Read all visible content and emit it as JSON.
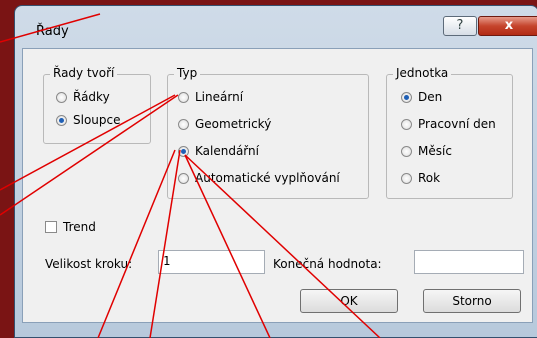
{
  "window": {
    "title": "Řady",
    "help_label": "?",
    "close_label": "x"
  },
  "groups": {
    "rady_tvori": {
      "legend": "Řady tvoří",
      "options": [
        "Řádky",
        "Sloupce"
      ],
      "selected": "Sloupce"
    },
    "typ": {
      "legend": "Typ",
      "options": [
        "Lineární",
        "Geometrický",
        "Kalendářní",
        "Automatické vyplňování"
      ],
      "selected": "Kalendářní"
    },
    "jednotka": {
      "legend": "Jednotka",
      "options": [
        "Den",
        "Pracovní den",
        "Měsíc",
        "Rok"
      ],
      "selected": "Den"
    }
  },
  "trend": {
    "label": "Trend",
    "checked": false
  },
  "step": {
    "label": "Velikost kroku:",
    "value": "1"
  },
  "end": {
    "label": "Konečná hodnota:",
    "value": ""
  },
  "buttons": {
    "ok": "OK",
    "cancel": "Storno"
  },
  "annotation": {
    "color": "#e00000"
  }
}
